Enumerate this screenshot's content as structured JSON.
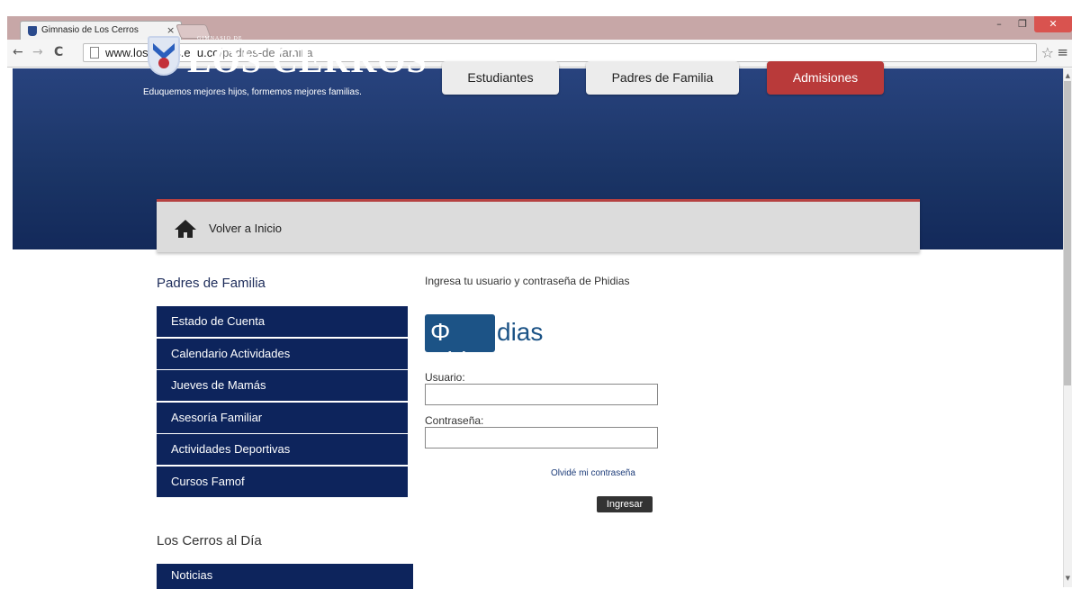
{
  "browser": {
    "tab_title": "Gimnasio de Los Cerros",
    "tab_close": "×",
    "url_host": "www.loscerros.edu.co",
    "url_path": "/padres-de-familia",
    "win_min": "–",
    "win_restore": "❐",
    "win_close": "✕",
    "nav_back": "←",
    "nav_forward": "→",
    "nav_reload": "C",
    "star": "☆",
    "menu": "≡"
  },
  "header": {
    "logo_small": "GIMNASIO DE",
    "logo_name": "LOS CERROS",
    "tagline": "Eduquemos mejores hijos, formemos mejores familias.",
    "buttons": [
      "Estudiantes",
      "Padres de Familia",
      "Admisiones"
    ]
  },
  "backbar": {
    "label": "Volver a Inicio"
  },
  "sidebar": {
    "title": "Padres de Familia",
    "items": [
      "Estado de Cuenta",
      "Calendario Actividades",
      "Jueves de Mamás",
      "Asesoría Familiar",
      "Actividades Deportivas",
      "Cursos Famof"
    ],
    "title2": "Los Cerros al Día",
    "items2": [
      "Noticias"
    ]
  },
  "login": {
    "intro": "Ingresa tu usuario y contraseña de Phidias",
    "logo_phi": "Φ Phi",
    "logo_dias": "dias",
    "user_label": "Usuario:",
    "user_value": "",
    "pass_label": "Contraseña:",
    "pass_value": "",
    "forgot": "Olvidé mi contraseña",
    "submit": "Ingresar"
  },
  "colors": {
    "header_blue": "#1a3465",
    "nav_item_blue": "#0d245c",
    "admisiones_red": "#b93a3a",
    "phidias_blue": "#1c5386"
  }
}
